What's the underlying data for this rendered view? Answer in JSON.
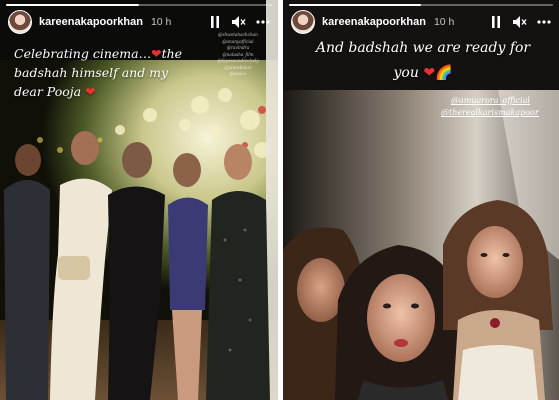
{
  "stories": [
    {
      "id": "left",
      "progress": 0.5,
      "username": "kareenakapoorkhan",
      "timestamp": "10 h",
      "caption_line1": "Celebrating cinema…",
      "caption_line2": "the badshah himself and my dear Pooja",
      "tags_overlay": [
        "@shwetabachchan",
        "@ananyafficial",
        "@ravindra",
        "@natasha_film",
        "@fayesoundmelody",
        "@jawedkhan",
        "@peace"
      ]
    },
    {
      "id": "right",
      "progress": 0.5,
      "username": "kareenakapoorkhan",
      "timestamp": "10 h",
      "caption": "And badshah we are ready for you",
      "mentions": [
        "@amuarora_official",
        "@therealkarismakapoor"
      ]
    }
  ],
  "icons": {
    "pause": "pause-icon",
    "mute": "speaker-muted-icon",
    "more": "more-options-icon",
    "heart": "red-heart-emoji",
    "rainbow": "rainbow-emoji"
  },
  "colors": {
    "heart": "#e8322d",
    "background": "#0d0d0d"
  }
}
